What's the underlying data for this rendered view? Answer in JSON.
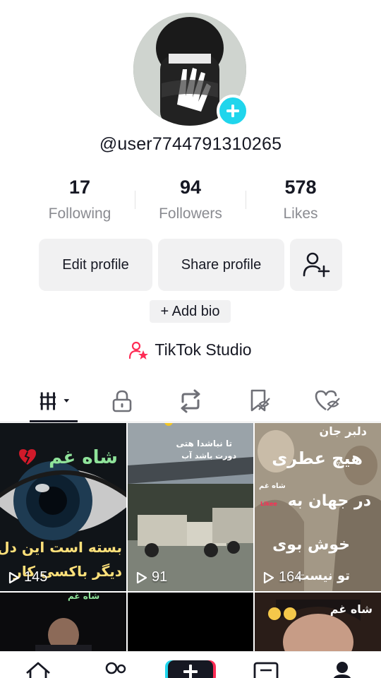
{
  "profile": {
    "username": "@user7744791310265",
    "stats": [
      {
        "value": "17",
        "label": "Following"
      },
      {
        "value": "94",
        "label": "Followers"
      },
      {
        "value": "578",
        "label": "Likes"
      }
    ],
    "buttons": {
      "edit": "Edit profile",
      "share": "Share profile"
    },
    "add_bio": "+ Add bio",
    "studio": "TikTok Studio"
  },
  "tabs": [
    "videos-tab",
    "private-tab",
    "reposts-tab",
    "favorites-tab",
    "liked-tab"
  ],
  "videos": [
    {
      "views": "145",
      "overlay": "شاه غم",
      "overlay2": "بسته است این دل",
      "overlay3": "دیگر باکسی کار"
    },
    {
      "views": "91",
      "overlay": "تا نباشدا هتی",
      "overlay2": "دورت باشد آب"
    },
    {
      "views": "164",
      "overlay": "دلبر جان",
      "overlay2": "هیچ عطری",
      "overlay3": "در جهان به",
      "overlay4": "خوش بوی",
      "overlay5": "تو نیست",
      "overlay6": "شاه غم",
      "overlay7": "Likee"
    },
    {
      "views": "",
      "overlay": "شاه غم"
    },
    {
      "views": ""
    },
    {
      "views": "",
      "overlay": "شاه غم"
    }
  ],
  "colors": {
    "accent": "#20d5ec",
    "brand_red": "#fe2c55",
    "text": "#161823",
    "muted": "#8a8b91",
    "button_bg": "#f1f1f2"
  }
}
